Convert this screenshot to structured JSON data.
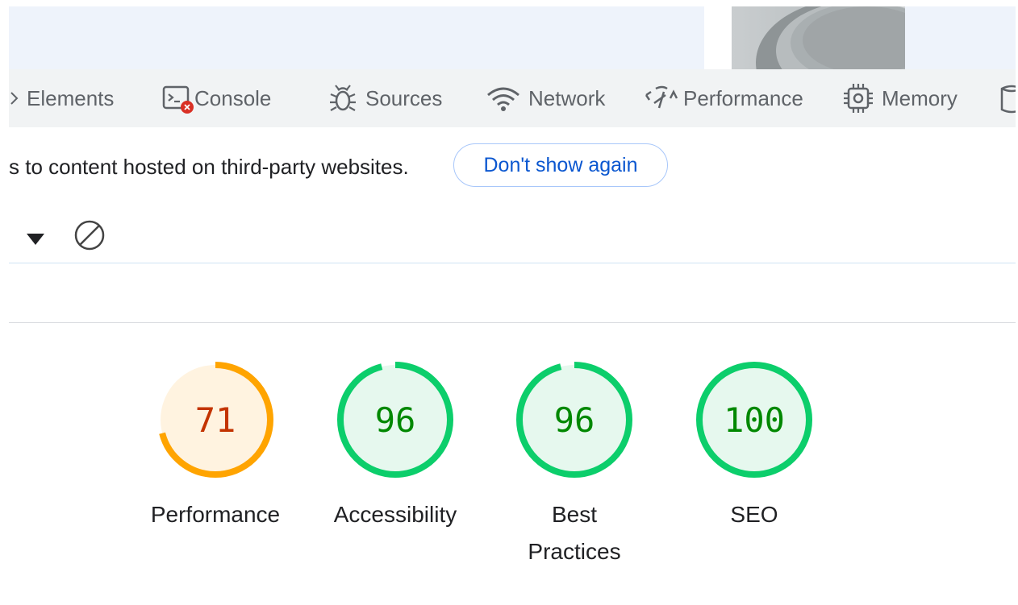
{
  "tabs": [
    {
      "label": "Elements",
      "icon": "chevron-right-icon"
    },
    {
      "label": "Console",
      "icon": "console-icon"
    },
    {
      "label": "Sources",
      "icon": "bug-icon"
    },
    {
      "label": "Network",
      "icon": "wifi-icon"
    },
    {
      "label": "Performance",
      "icon": "speedometer-icon"
    },
    {
      "label": "Memory",
      "icon": "chip-icon"
    }
  ],
  "info_bar": {
    "text": "s to content hosted on third-party websites.",
    "dismiss_label": "Don't show again"
  },
  "scores": [
    {
      "value": "71",
      "label": "Performance",
      "fraction": 0.71,
      "color": "#ffa400",
      "bg": "#fff3e0",
      "text_color": "#c33300"
    },
    {
      "value": "96",
      "label": "Accessibility",
      "fraction": 0.96,
      "color": "#0cce6b",
      "bg": "#e6f8ee",
      "text_color": "#008800"
    },
    {
      "value": "96",
      "label": "Best Practices",
      "fraction": 0.96,
      "color": "#0cce6b",
      "bg": "#e6f8ee",
      "text_color": "#008800"
    },
    {
      "value": "100",
      "label": "SEO",
      "fraction": 1.0,
      "color": "#0cce6b",
      "bg": "#e6f8ee",
      "text_color": "#008800"
    }
  ],
  "colors": {
    "error_badge": "#d93025",
    "link_blue": "#0b57d0"
  }
}
